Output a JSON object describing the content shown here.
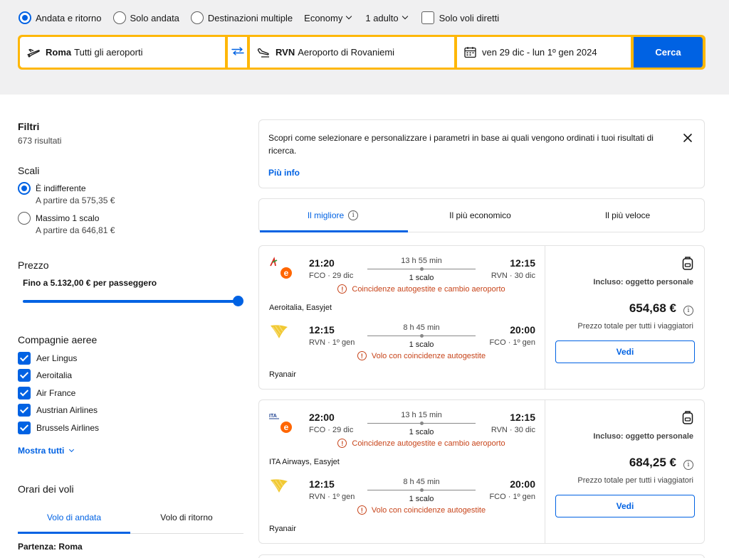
{
  "trip": {
    "options": [
      "Andata e ritorno",
      "Solo andata",
      "Destinazioni multiple"
    ],
    "selected": 0,
    "cabin": "Economy",
    "passengers": "1 adulto",
    "direct_only": "Solo voli diretti"
  },
  "search": {
    "origin_code": "Roma",
    "origin_name": "Tutti gli aeroporti",
    "dest_code": "RVN",
    "dest_name": "Aeroporto di Rovaniemi",
    "dates": "ven 29 dic - lun 1º gen 2024",
    "button": "Cerca"
  },
  "filters": {
    "title": "Filtri",
    "results": "673 risultati",
    "stops_title": "Scali",
    "stops": [
      {
        "label": "È indifferente",
        "sub": "A partire da 575,35 €",
        "selected": true
      },
      {
        "label": "Massimo 1 scalo",
        "sub": "A partire da 646,81 €",
        "selected": false
      }
    ],
    "price_title": "Prezzo",
    "price_label": "Fino a 5.132,00 € per passeggero",
    "price_fraction": 1.0,
    "airlines_title": "Compagnie aeree",
    "airlines": [
      "Aer Lingus",
      "Aeroitalia",
      "Air France",
      "Austrian Airlines",
      "Brussels Airlines"
    ],
    "show_all": "Mostra tutti",
    "times_title": "Orari dei voli",
    "times_tabs": [
      "Volo di andata",
      "Volo di ritorno"
    ],
    "departure": "Partenza: Roma"
  },
  "info": {
    "text": "Scopri come selezionare e personalizzare i parametri in base ai quali vengono ordinati i tuoi risultati di ricerca.",
    "link": "Più info"
  },
  "sort": {
    "tabs": [
      "Il migliore",
      "Il più economico",
      "Il più veloce"
    ],
    "info_glyph": "i"
  },
  "cards": [
    {
      "legs": [
        {
          "dep_time": "21:20",
          "dep_airport": "FCO · 29 dic",
          "arr_time": "12:15",
          "arr_airport": "RVN · 30 dic",
          "duration": "13 h 55 min",
          "stops": "1 scalo",
          "warning": "Coincidenze autogestite e cambio aeroporto",
          "carrier": "Aeroitalia, Easyjet",
          "logo": "aeroitalia-easyjet-logo"
        },
        {
          "dep_time": "12:15",
          "dep_airport": "RVN · 1º gen",
          "arr_time": "20:00",
          "arr_airport": "FCO · 1º gen",
          "duration": "8 h 45 min",
          "stops": "1 scalo",
          "warning": "Volo con coincidenze autogestite",
          "carrier": "Ryanair",
          "logo": "ryanair-logo"
        }
      ],
      "included": "Incluso: oggetto personale",
      "price": "654,68 €",
      "total": "Prezzo totale per tutti i viaggiatori",
      "button": "Vedi"
    },
    {
      "legs": [
        {
          "dep_time": "22:00",
          "dep_airport": "FCO · 29 dic",
          "arr_time": "12:15",
          "arr_airport": "RVN · 30 dic",
          "duration": "13 h 15 min",
          "stops": "1 scalo",
          "warning": "Coincidenze autogestite e cambio aeroporto",
          "carrier": "ITA Airways, Easyjet",
          "logo": "ita-easyjet-logo"
        },
        {
          "dep_time": "12:15",
          "dep_airport": "RVN · 1º gen",
          "arr_time": "20:00",
          "arr_airport": "FCO · 1º gen",
          "duration": "8 h 45 min",
          "stops": "1 scalo",
          "warning": "Volo con coincidenze autogestite",
          "carrier": "Ryanair",
          "logo": "ryanair-logo"
        }
      ],
      "included": "Incluso: oggetto personale",
      "price": "684,25 €",
      "total": "Prezzo totale per tutti i viaggiatori",
      "button": "Vedi"
    }
  ],
  "colors": {
    "accent": "#0062e3",
    "search_border": "#feb708",
    "warning": "#c7441a"
  },
  "icons": [
    "plane-takeoff-icon",
    "swap-icon",
    "plane-landing-icon",
    "calendar-icon",
    "close-icon",
    "info-icon",
    "warning-icon",
    "bag-icon"
  ]
}
